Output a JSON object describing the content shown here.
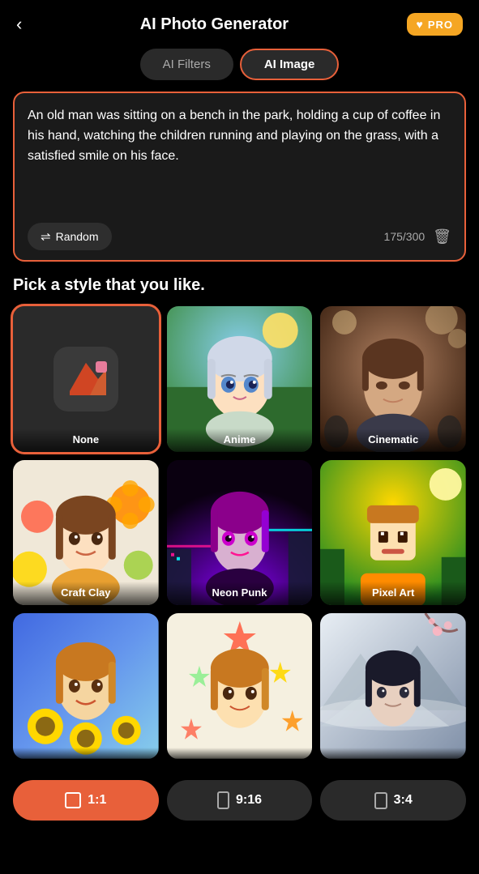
{
  "header": {
    "back_label": "‹",
    "title": "AI Photo Generator",
    "pro_label": "PRO",
    "pro_icon": "♥"
  },
  "tabs": [
    {
      "id": "ai-filters",
      "label": "AI Filters",
      "active": false
    },
    {
      "id": "ai-image",
      "label": "AI Image",
      "active": true
    }
  ],
  "prompt": {
    "text": "An old man was sitting on a bench in the park, holding a cup of coffee in his hand, watching the children running and playing on the grass, with a satisfied smile on his face.",
    "random_label": "Random",
    "char_count": "175/300"
  },
  "style_section": {
    "title": "Pick a style that you like."
  },
  "styles": [
    {
      "id": "none",
      "label": "None",
      "selected": true
    },
    {
      "id": "anime",
      "label": "Anime",
      "selected": false
    },
    {
      "id": "cinematic",
      "label": "Cinematic",
      "selected": false
    },
    {
      "id": "craft-clay",
      "label": "Craft Clay",
      "selected": false
    },
    {
      "id": "neon-punk",
      "label": "Neon Punk",
      "selected": false
    },
    {
      "id": "pixel-art",
      "label": "Pixel Art",
      "selected": false
    },
    {
      "id": "row3-left",
      "label": "",
      "selected": false
    },
    {
      "id": "row3-mid",
      "label": "",
      "selected": false
    },
    {
      "id": "row3-right",
      "label": "",
      "selected": false
    }
  ],
  "ratios": [
    {
      "id": "1:1",
      "label": "1:1",
      "active": true,
      "icon": "▭"
    },
    {
      "id": "9:16",
      "label": "9:16",
      "active": false,
      "icon": "▯"
    },
    {
      "id": "3:4",
      "label": "3:4",
      "active": false,
      "icon": "▯"
    }
  ]
}
